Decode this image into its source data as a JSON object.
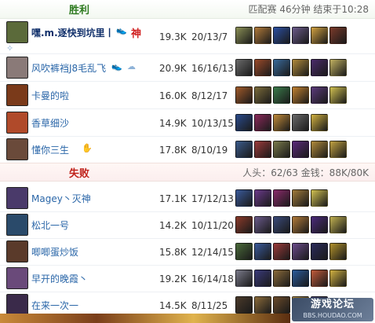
{
  "win_section": {
    "title": "胜利",
    "meta": "匹配赛 46分钟 结束于10:28"
  },
  "lose_section": {
    "title": "失败",
    "meta": "人头：62/63 金钱：88K/80K"
  },
  "players": [
    {
      "name": "嘿.m.逐快到坑里丨",
      "score": "19.3K",
      "kda": "20/13/7",
      "badge": "神",
      "champ_color": "#5b6a3a",
      "items": [
        "#8a8f55",
        "#b07a3a",
        "#2c4fa0",
        "#6b5a8a",
        "#d0a040",
        "#7a3a2a"
      ]
    },
    {
      "name": "风吹裤裆J8毛乱飞",
      "score": "20.9K",
      "kda": "16/16/13",
      "champ_color": "#8a7a78",
      "items": [
        "#6a6a6a",
        "#9a4a2a",
        "#3a6a9a",
        "#b08a3a",
        "#4a2a6a",
        "#c0b060"
      ]
    },
    {
      "name": "卡曼的啦",
      "score": "16.0K",
      "kda": "8/12/17",
      "champ_color": "#7a3a1a",
      "items": [
        "#a05a2a",
        "#7a6a3a",
        "#3a7a4a",
        "#c08030",
        "#5a3a7a",
        "#d0c050"
      ]
    },
    {
      "name": "香草细沙",
      "score": "14.9K",
      "kda": "10/13/15",
      "champ_color": "#b04a2a",
      "items": [
        "#2a4a8a",
        "#8a2a5a",
        "#c08a3a",
        "#6a6a6a",
        "#d0b040"
      ]
    },
    {
      "name": "懂你三生",
      "score": "17.8K",
      "kda": "8/10/19",
      "champ_color": "#6a4a3a",
      "items": [
        "#3a5a8a",
        "#9a3a3a",
        "#7a7a4a",
        "#5a2a7a",
        "#b08a3a",
        "#c0a040"
      ]
    },
    {
      "name": "Magey丶灭神",
      "score": "17.1K",
      "kda": "17/12/13",
      "champ_color": "#4a3a6a",
      "items": [
        "#3a5a9a",
        "#6a3a8a",
        "#8a2a6a",
        "#a07a3a",
        "#d0c050"
      ]
    },
    {
      "name": "松北一号",
      "score": "14.2K",
      "kda": "10/11/20",
      "champ_color": "#2a4a6a",
      "items": [
        "#8a3a2a",
        "#6a5a8a",
        "#3a4a7a",
        "#b07a3a",
        "#4a2a7a",
        "#c0b050"
      ]
    },
    {
      "name": "唧唧蛋炒饭",
      "score": "15.8K",
      "kda": "12/14/15",
      "champ_color": "#5a3a2a",
      "items": [
        "#4a6a3a",
        "#3a5a9a",
        "#9a3a3a",
        "#6a4a8a",
        "#2a2a5a",
        "#b0902a"
      ]
    },
    {
      "name": "早开的晚霞丶",
      "score": "19.2K",
      "kda": "16/14/18",
      "champ_color": "#6a4a7a",
      "items": [
        "#7a7a8a",
        "#3a3a7a",
        "#8a6a3a",
        "#2a5a9a",
        "#c05a3a",
        "#d0b040"
      ]
    },
    {
      "name": "在来一次一",
      "score": "14.5K",
      "kda": "8/11/25",
      "champ_color": "#3a2a4a",
      "items": [
        "#4a3a2a",
        "#8a6a3a",
        "#6a4a2a",
        "#b08a3a",
        "#3a3a6a"
      ]
    }
  ],
  "watermark": {
    "main": "游戏论坛",
    "sub": "BBS.HOUDAO.COM"
  }
}
